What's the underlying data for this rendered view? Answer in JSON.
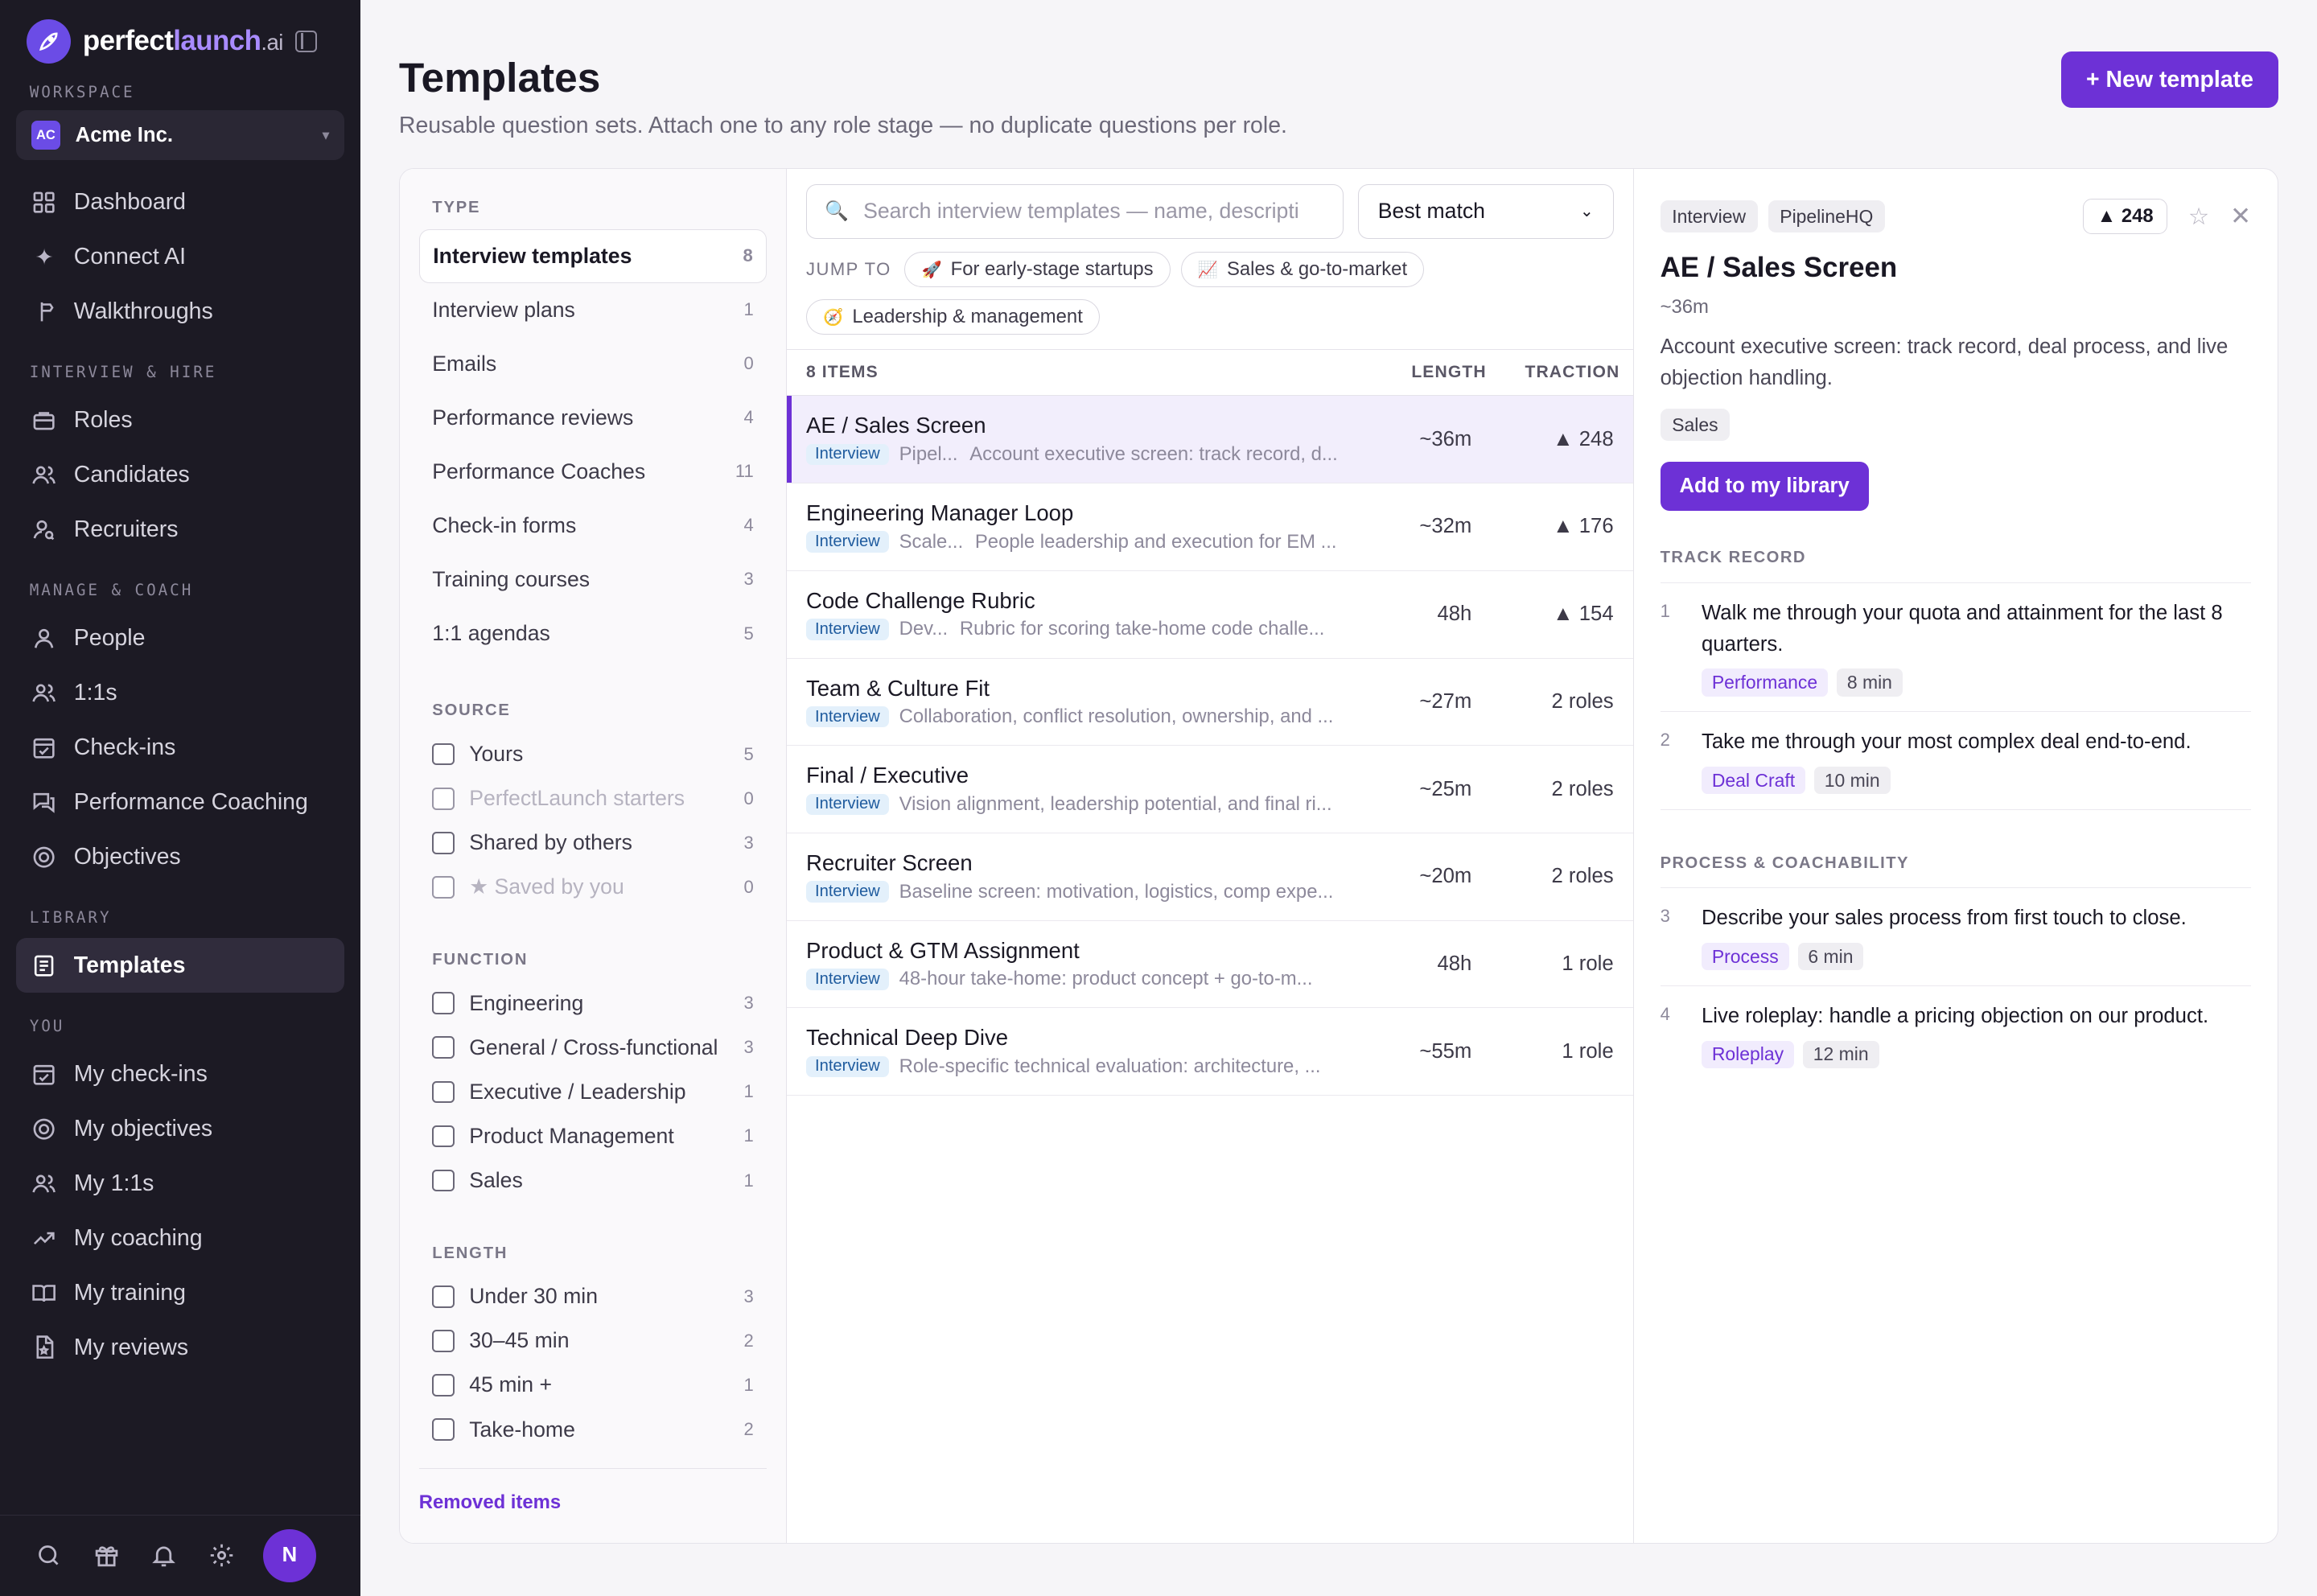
{
  "brand": {
    "part1": "perfect",
    "part2": "launch",
    "part3": ".ai"
  },
  "workspace": {
    "label": "WORKSPACE",
    "badge": "AC",
    "name": "Acme Inc."
  },
  "nav": {
    "top": [
      {
        "label": "Dashboard"
      },
      {
        "label": "Connect AI"
      },
      {
        "label": "Walkthroughs"
      }
    ],
    "interview_label": "INTERVIEW & HIRE",
    "interview": [
      {
        "label": "Roles"
      },
      {
        "label": "Candidates"
      },
      {
        "label": "Recruiters"
      }
    ],
    "manage_label": "MANAGE & COACH",
    "manage": [
      {
        "label": "People"
      },
      {
        "label": "1:1s"
      },
      {
        "label": "Check-ins"
      },
      {
        "label": "Performance Coaching"
      },
      {
        "label": "Objectives"
      }
    ],
    "library_label": "LIBRARY",
    "library": [
      {
        "label": "Templates"
      }
    ],
    "you_label": "YOU",
    "you": [
      {
        "label": "My check-ins"
      },
      {
        "label": "My objectives"
      },
      {
        "label": "My 1:1s"
      },
      {
        "label": "My coaching"
      },
      {
        "label": "My training"
      },
      {
        "label": "My reviews"
      }
    ]
  },
  "user": {
    "initial": "N"
  },
  "header": {
    "title": "Templates",
    "subtitle": "Reusable question sets. Attach one to any role stage — no duplicate questions per role.",
    "new_button": "+ New template"
  },
  "filters": {
    "type_label": "TYPE",
    "types": [
      {
        "label": "Interview templates",
        "count": "8"
      },
      {
        "label": "Interview plans",
        "count": "1"
      },
      {
        "label": "Emails",
        "count": "0"
      },
      {
        "label": "Performance reviews",
        "count": "4"
      },
      {
        "label": "Performance Coaches",
        "count": "11"
      },
      {
        "label": "Check-in forms",
        "count": "4"
      },
      {
        "label": "Training courses",
        "count": "3"
      },
      {
        "label": "1:1 agendas",
        "count": "5"
      }
    ],
    "source_label": "SOURCE",
    "sources": [
      {
        "label": "Yours",
        "count": "5"
      },
      {
        "label": "PerfectLaunch starters",
        "count": "0"
      },
      {
        "label": "Shared by others",
        "count": "3"
      },
      {
        "label": "★ Saved by you",
        "count": "0"
      }
    ],
    "function_label": "FUNCTION",
    "functions": [
      {
        "label": "Engineering",
        "count": "3"
      },
      {
        "label": "General / Cross-functional",
        "count": "3"
      },
      {
        "label": "Executive / Leadership",
        "count": "1"
      },
      {
        "label": "Product Management",
        "count": "1"
      },
      {
        "label": "Sales",
        "count": "1"
      }
    ],
    "length_label": "LENGTH",
    "lengths": [
      {
        "label": "Under 30 min",
        "count": "3"
      },
      {
        "label": "30–45 min",
        "count": "2"
      },
      {
        "label": "45 min +",
        "count": "1"
      },
      {
        "label": "Take-home",
        "count": "2"
      }
    ],
    "removed": "Removed items"
  },
  "list": {
    "search_placeholder": "Search interview templates — name, descripti",
    "sort": "Best match",
    "jump_label": "JUMP TO",
    "chips": [
      {
        "emoji": "🚀",
        "label": "For early-stage startups"
      },
      {
        "emoji": "📈",
        "label": "Sales & go-to-market"
      },
      {
        "emoji": "🧭",
        "label": "Leadership & management"
      }
    ],
    "count_label": "8 ITEMS",
    "col_length": "LENGTH",
    "col_traction": "TRACTION",
    "items": [
      {
        "title": "AE / Sales Screen",
        "tag": "Interview",
        "source": "Pipel...",
        "desc": "Account executive screen: track record, d...",
        "length": "~36m",
        "traction": "▲ 248"
      },
      {
        "title": "Engineering Manager Loop",
        "tag": "Interview",
        "source": "Scale...",
        "desc": "People leadership and execution for EM ...",
        "length": "~32m",
        "traction": "▲ 176"
      },
      {
        "title": "Code Challenge Rubric",
        "tag": "Interview",
        "source": "Dev...",
        "desc": "Rubric for scoring take-home code challe...",
        "length": "48h",
        "traction": "▲ 154"
      },
      {
        "title": "Team & Culture Fit",
        "tag": "Interview",
        "source": "",
        "desc": "Collaboration, conflict resolution, ownership, and ...",
        "length": "~27m",
        "traction": "2 roles"
      },
      {
        "title": "Final / Executive",
        "tag": "Interview",
        "source": "",
        "desc": "Vision alignment, leadership potential, and final ri...",
        "length": "~25m",
        "traction": "2 roles"
      },
      {
        "title": "Recruiter Screen",
        "tag": "Interview",
        "source": "",
        "desc": "Baseline screen: motivation, logistics, comp expe...",
        "length": "~20m",
        "traction": "2 roles"
      },
      {
        "title": "Product & GTM Assignment",
        "tag": "Interview",
        "source": "",
        "desc": "48-hour take-home: product concept + go-to-m...",
        "length": "48h",
        "traction": "1 role"
      },
      {
        "title": "Technical Deep Dive",
        "tag": "Interview",
        "source": "",
        "desc": "Role-specific technical evaluation: architecture, ...",
        "length": "~55m",
        "traction": "1 role"
      }
    ]
  },
  "detail": {
    "pill_type": "Interview",
    "pill_source": "PipelineHQ",
    "votes": "▲ 248",
    "title": "AE / Sales Screen",
    "length": "~36m",
    "description": "Account executive screen: track record, deal process, and live objection handling.",
    "function_tag": "Sales",
    "add_button": "Add to my library",
    "sections": [
      {
        "title": "TRACK RECORD",
        "questions": [
          {
            "num": "1",
            "text": "Walk me through your quota and attainment for the last 8 quarters.",
            "category": "Performance",
            "minutes": "8 min"
          },
          {
            "num": "2",
            "text": "Take me through your most complex deal end-to-end.",
            "category": "Deal Craft",
            "minutes": "10 min"
          }
        ]
      },
      {
        "title": "PROCESS & COACHABILITY",
        "questions": [
          {
            "num": "3",
            "text": "Describe your sales process from first touch to close.",
            "category": "Process",
            "minutes": "6 min"
          },
          {
            "num": "4",
            "text": "Live roleplay: handle a pricing objection on our product.",
            "category": "Roleplay",
            "minutes": "12 min"
          }
        ]
      }
    ]
  }
}
